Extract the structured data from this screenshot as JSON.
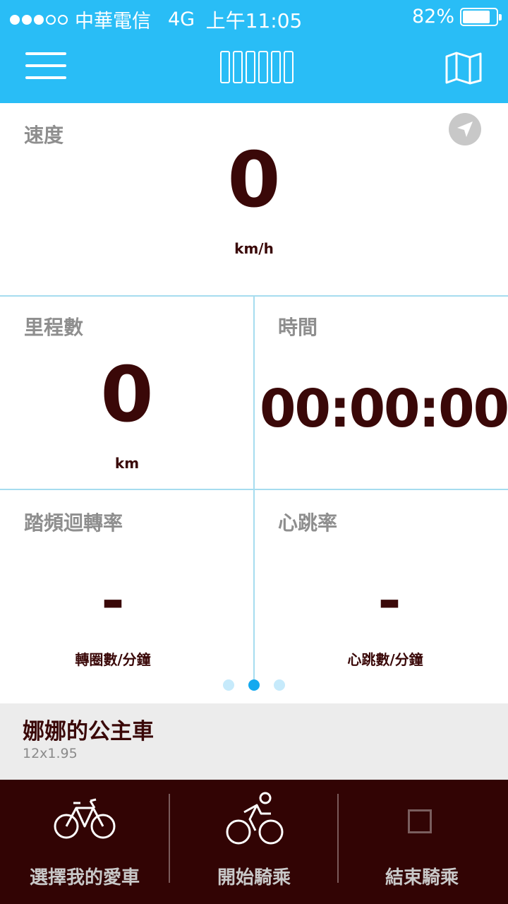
{
  "status_bar": {
    "carrier": "中華電信",
    "network": "4G",
    "time": "上午11:05",
    "battery_percent_text": "82%",
    "battery_level": 0.82,
    "signal_bars_filled": 3,
    "signal_bars_total": 5
  },
  "nav": {
    "menu_icon": "hamburger-menu-icon",
    "title_placeholder": "□□□□□□",
    "map_icon": "map-icon"
  },
  "speed": {
    "label": "速度",
    "value": "0",
    "unit": "km/h"
  },
  "distance": {
    "label": "里程數",
    "value": "0",
    "unit": "km"
  },
  "time_panel": {
    "label": "時間",
    "value": "00:00:00"
  },
  "cadence": {
    "label": "踏頻迴轉率",
    "value": "-",
    "unit": "轉圈數/分鐘"
  },
  "heart_rate": {
    "label": "心跳率",
    "value": "-",
    "unit": "心跳數/分鐘"
  },
  "pager": {
    "count": 3,
    "active_index": 1
  },
  "bike": {
    "name": "娜娜的公主車",
    "size": "12x1.95"
  },
  "bottom": {
    "select_bike_label": "選擇我的愛車",
    "start_ride_label": "開始騎乘",
    "end_ride_label": "結束騎乘"
  },
  "colors": {
    "header_bg": "#29bdf6",
    "value_text": "#3a0808",
    "bottom_bg": "#320404",
    "grid_line": "#a6dcef",
    "pager_active": "#14a9ef"
  }
}
